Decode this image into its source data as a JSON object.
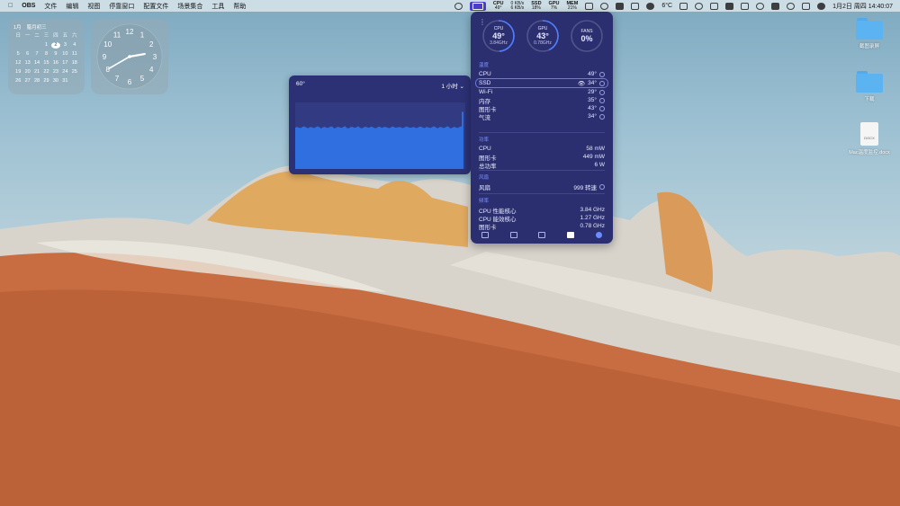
{
  "menubar": {
    "app_name": "OBS",
    "menus": [
      "文件",
      "编辑",
      "视图",
      "停靠窗口",
      "配置文件",
      "场景集合",
      "工具",
      "帮助"
    ],
    "status": {
      "cpu_label": "CPU",
      "cpu_value": "49°",
      "net_up": "0 KB/s",
      "net_down": "6 KB/s",
      "ssd_label": "SSD",
      "ssd_value": "18%",
      "gpu_label": "GPU",
      "gpu_value": "7%",
      "mem_label": "MEM",
      "mem_value": "21%",
      "weather": "6°C",
      "datetime": "1月2日 周四  14:40:07"
    }
  },
  "calendar": {
    "month": "1月",
    "lunar": "腊月初三",
    "weekdays": [
      "日",
      "一",
      "二",
      "三",
      "四",
      "五",
      "六"
    ],
    "rows": [
      [
        "",
        "",
        "",
        "1",
        "2",
        "3",
        "4"
      ],
      [
        "5",
        "6",
        "7",
        "8",
        "9",
        "10",
        "11"
      ],
      [
        "12",
        "13",
        "14",
        "15",
        "16",
        "17",
        "18"
      ],
      [
        "19",
        "20",
        "21",
        "22",
        "23",
        "24",
        "25"
      ],
      [
        "26",
        "27",
        "28",
        "29",
        "30",
        "31",
        ""
      ]
    ],
    "today": "2"
  },
  "clock": {
    "numbers": [
      "12",
      "1",
      "2",
      "3",
      "4",
      "5",
      "6",
      "7",
      "8",
      "9",
      "10",
      "11"
    ],
    "hour": 14,
    "minute": 40
  },
  "graph_popup": {
    "max_label": "60°",
    "range_label": "1 小时",
    "chevron": "⌄"
  },
  "panel": {
    "gauges": [
      {
        "name": "CPU",
        "value": "49°",
        "sub": "3.84GHz",
        "fill": 0.49
      },
      {
        "name": "GPU",
        "value": "43°",
        "sub": "0.78GHz",
        "fill": 0.43
      },
      {
        "name": "FANS",
        "value": "0%",
        "sub": "",
        "fill": 0.0
      }
    ],
    "temp_section": {
      "title": "温度",
      "rows": [
        {
          "label": "CPU",
          "value": "49°"
        },
        {
          "label": "SSD",
          "value": "34°"
        },
        {
          "label": "Wi-Fi",
          "value": "29°"
        },
        {
          "label": "内存",
          "value": "35°"
        },
        {
          "label": "图形卡",
          "value": "43°"
        },
        {
          "label": "气流",
          "value": "34°"
        }
      ]
    },
    "power_section": {
      "title": "功率",
      "rows": [
        {
          "label": "CPU",
          "value": "58 mW"
        },
        {
          "label": "图形卡",
          "value": "449 mW"
        },
        {
          "label": "总功率",
          "value": "6 W"
        }
      ]
    },
    "fan_section": {
      "title": "风扇",
      "rows": [
        {
          "label": "风扇",
          "value": "999 转速"
        }
      ]
    },
    "freq_section": {
      "title": "频率",
      "rows": [
        {
          "label": "CPU 性能核心",
          "value": "3.84 GHz"
        },
        {
          "label": "CPU 能效核心",
          "value": "1.27 GHz"
        },
        {
          "label": "图形卡",
          "value": "0.78 GHz"
        }
      ]
    }
  },
  "desktop": [
    {
      "name": "folder-1",
      "kind": "folder",
      "label": "截图录屏"
    },
    {
      "name": "folder-2",
      "kind": "folder",
      "label": "下载"
    },
    {
      "name": "docx-file",
      "kind": "doc",
      "label": "Mac温度监控.docx",
      "badge": "DOCX"
    }
  ]
}
